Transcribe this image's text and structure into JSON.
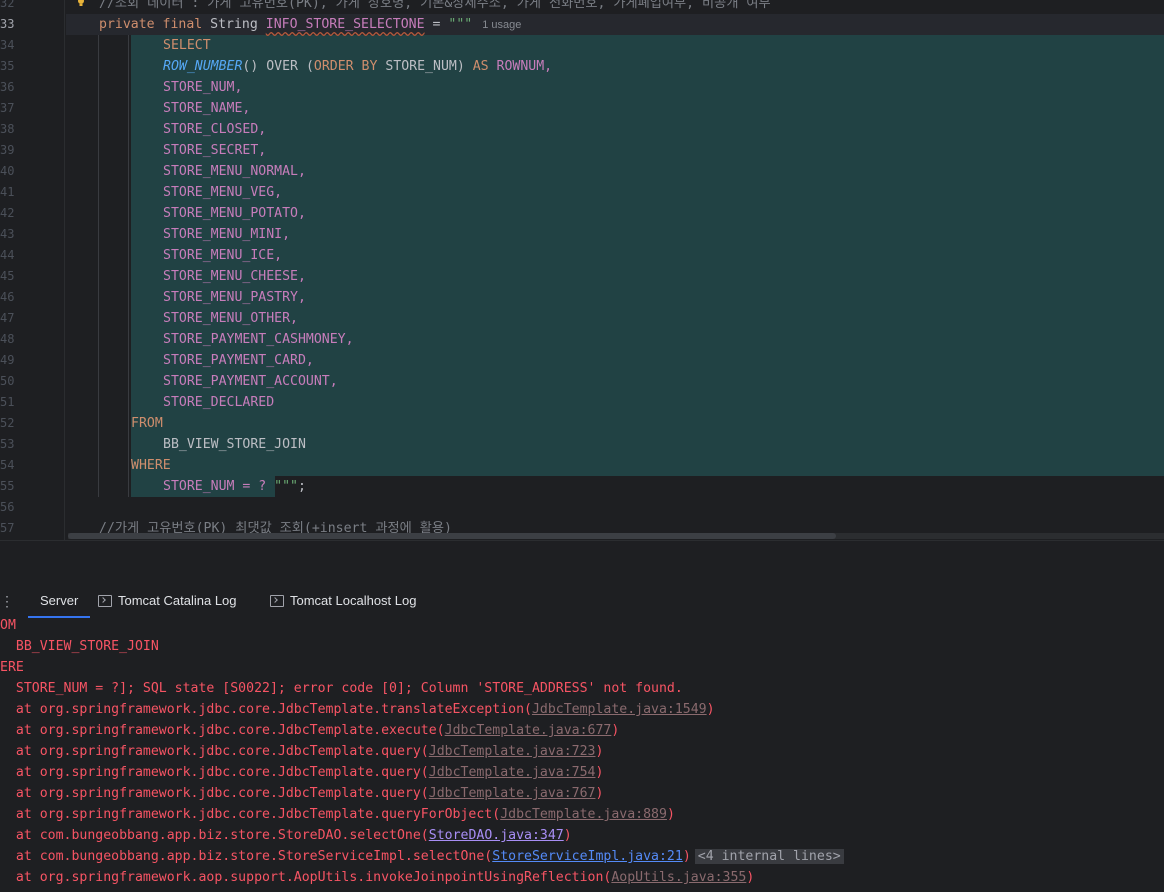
{
  "editor": {
    "line_numbers": [
      "32",
      "33",
      "34",
      "35",
      "36",
      "37",
      "38",
      "39",
      "40",
      "41",
      "42",
      "43",
      "44",
      "45",
      "46",
      "47",
      "48",
      "49",
      "50",
      "51",
      "52",
      "53",
      "54",
      "55",
      "56",
      "57"
    ],
    "active_line": "33",
    "comment_top": "//조회 데이터 : 가게 고유번호(PK), 가게 상호명, 기본&상세주소, 가게 전화번호, 가게폐업여부, 비공개 여부",
    "decl": {
      "modifiers": "private final",
      "type": "String",
      "name": "INFO_STORE_SELECTONE",
      "assign": " = ",
      "open_quote": "\"\"\"",
      "usage_hint": "1 usage"
    },
    "sql": {
      "select": "SELECT",
      "rownum_fn": "ROW_NUMBER",
      "rownum_rest_a": "() ",
      "over": "OVER",
      "rownum_rest_b": " (",
      "order_by": "ORDER BY",
      "rownum_rest_c": " STORE_NUM) ",
      "as": "AS",
      "rownum_alias": " ROWNUM,",
      "columns": [
        "STORE_NUM,",
        "STORE_NAME,",
        "STORE_CLOSED,",
        "STORE_SECRET,",
        "STORE_MENU_NORMAL,",
        "STORE_MENU_VEG,",
        "STORE_MENU_POTATO,",
        "STORE_MENU_MINI,",
        "STORE_MENU_ICE,",
        "STORE_MENU_CHEESE,",
        "STORE_MENU_PASTRY,",
        "STORE_MENU_OTHER,",
        "STORE_PAYMENT_CASHMONEY,",
        "STORE_PAYMENT_CARD,",
        "STORE_PAYMENT_ACCOUNT,",
        "STORE_DECLARED"
      ],
      "from": "FROM",
      "table": "BB_VIEW_STORE_JOIN",
      "where": "WHERE",
      "where_cond": "STORE_NUM = ? ",
      "close_quote": "\"\"\"",
      "semicolon": ";"
    },
    "comment_bottom": "//가게 고유번호(PK) 최댓값 조회(+insert 과정에 활용)"
  },
  "panel": {
    "menu_icon": "⋮",
    "tabs": [
      {
        "label": "Server",
        "icon": ""
      },
      {
        "label": "Tomcat Catalina Log",
        "icon": "terminal-icon"
      },
      {
        "label": "Tomcat Localhost Log",
        "icon": "terminal-icon"
      }
    ],
    "active_tab": "Server"
  },
  "console": {
    "lines": [
      {
        "text": "OM"
      },
      {
        "text": "  BB_VIEW_STORE_JOIN"
      },
      {
        "text": "ERE"
      },
      {
        "text": "  STORE_NUM = ?]; SQL state [S0022]; error code [0]; Column 'STORE_ADDRESS' not found."
      },
      {
        "text": "  at org.springframework.jdbc.core.JdbcTemplate.translateException(",
        "link": "JdbcTemplate.java:1549",
        "tail": ")",
        "style": "dim"
      },
      {
        "text": "  at org.springframework.jdbc.core.JdbcTemplate.execute(",
        "link": "JdbcTemplate.java:677",
        "tail": ")",
        "style": "dim"
      },
      {
        "text": "  at org.springframework.jdbc.core.JdbcTemplate.query(",
        "link": "JdbcTemplate.java:723",
        "tail": ")",
        "style": "dim"
      },
      {
        "text": "  at org.springframework.jdbc.core.JdbcTemplate.query(",
        "link": "JdbcTemplate.java:754",
        "tail": ")",
        "style": "dim"
      },
      {
        "text": "  at org.springframework.jdbc.core.JdbcTemplate.query(",
        "link": "JdbcTemplate.java:767",
        "tail": ")",
        "style": "dim"
      },
      {
        "text": "  at org.springframework.jdbc.core.JdbcTemplate.queryForObject(",
        "link": "JdbcTemplate.java:889",
        "tail": ")",
        "style": "dim"
      },
      {
        "text": "  at com.bungeobbang.app.biz.store.StoreDAO.selectOne(",
        "link": "StoreDAO.java:347",
        "tail": ")",
        "style": "purple"
      },
      {
        "text": "  at com.bungeobbang.app.biz.store.StoreServiceImpl.selectOne(",
        "link": "StoreServiceImpl.java:21",
        "tail": ")",
        "style": "blue",
        "internal": "<4 internal lines>"
      },
      {
        "text": "  at org.springframework.aop.support.AopUtils.invokeJoinpointUsingReflection(",
        "link": "AopUtils.java:355",
        "tail": ")",
        "style": "dim"
      }
    ]
  },
  "colors": {
    "background": "#1e1f22",
    "selection": "#214244",
    "error_text": "#f75464",
    "accent": "#3574f0"
  }
}
